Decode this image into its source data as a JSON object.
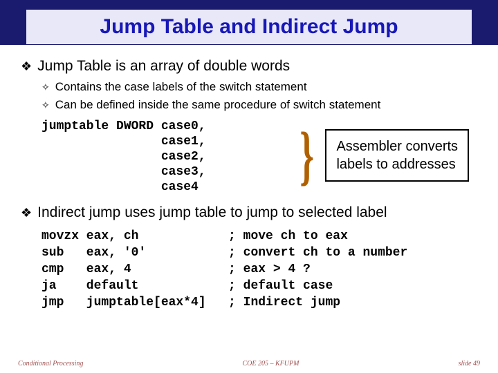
{
  "title": "Jump Table and Indirect Jump",
  "bullets": {
    "b1": "Jump Table is an array of double words",
    "b1_sub1": "Contains the case labels of the switch statement",
    "b1_sub2": "Can be defined inside the same procedure of switch statement",
    "b2": "Indirect jump uses jump table to jump to selected label"
  },
  "code1": "jumptable DWORD case0,\n                case1,\n                case2,\n                case3,\n                case4",
  "callout_line1": "Assembler converts",
  "callout_line2": "labels to addresses",
  "code2": "movzx eax, ch            ; move ch to eax\nsub   eax, '0'           ; convert ch to a number\ncmp   eax, 4             ; eax > 4 ?\nja    default            ; default case\njmp   jumptable[eax*4]   ; Indirect jump",
  "footer": {
    "left": "Conditional Processing",
    "center": "COE 205 – KFUPM",
    "right": "slide 49"
  }
}
